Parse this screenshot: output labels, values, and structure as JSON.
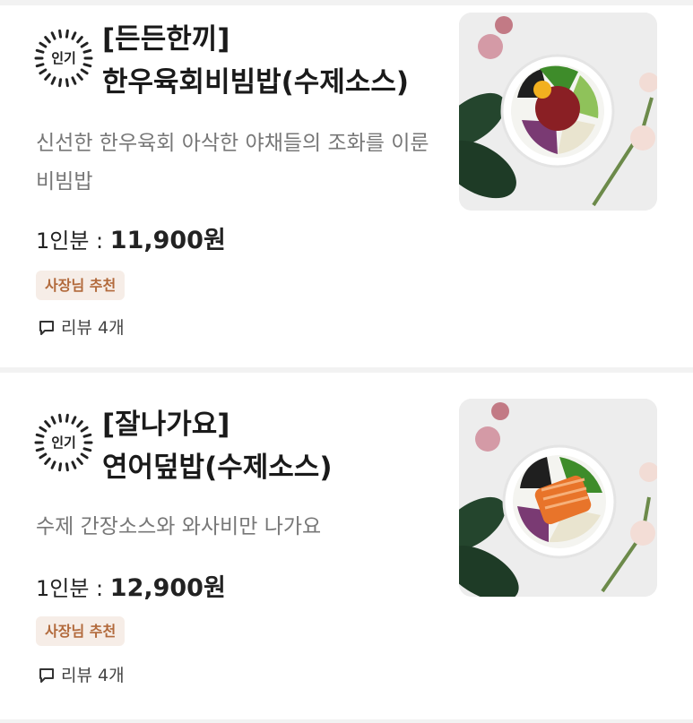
{
  "menu_items": [
    {
      "badge": "인기",
      "name_line1": "[든든한끼]",
      "name_line2": "한우육회비빔밥(수제소스)",
      "description": "신선한 한우육회 아삭한 야채들의 조화를 이룬 비빔밥",
      "portion_label": "1인분 : ",
      "price": "11,900원",
      "recommend_tag": "사장님 추천",
      "reviews": "리뷰 4개"
    },
    {
      "badge": "인기",
      "name_line1": "[잘나가요]",
      "name_line2": "연어덮밥(수제소스)",
      "description": "수제 간장소스와 와사비만 나가요",
      "portion_label": "1인분 : ",
      "price": "12,900원",
      "recommend_tag": "사장님 추천",
      "reviews": "리뷰 4개"
    }
  ],
  "colors": {
    "page_bg": "#f2f2f2",
    "card_bg": "#ffffff",
    "tag_bg": "#f6ede7",
    "tag_text": "#b26a3c",
    "description_text": "#777777"
  },
  "icons": {
    "badge": "sunburst-badge-icon",
    "reviews": "speech-bubble-icon",
    "photo_item_1": "bibimbap-bowl-photo",
    "photo_item_2": "salmon-rice-bowl-photo"
  }
}
